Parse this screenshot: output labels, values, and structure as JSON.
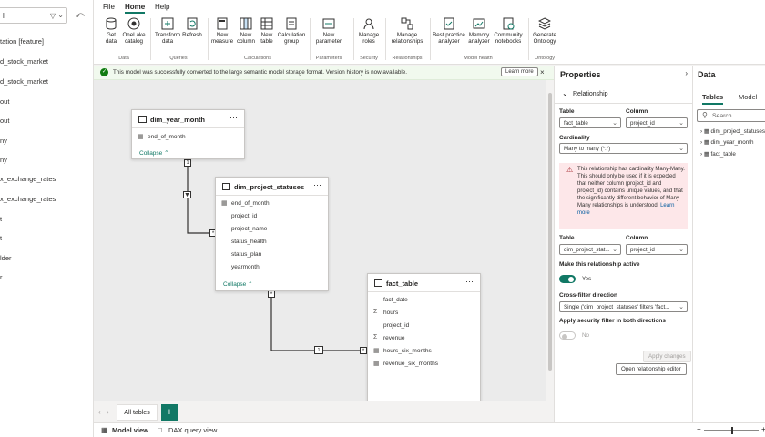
{
  "left_nav": {
    "search_value": "l",
    "items": [
      "tation [feature]",
      "d_stock_market",
      "d_stock_market",
      "out",
      "out",
      "ny",
      "ny",
      "x_exchange_rates",
      "x_exchange_rates",
      "t",
      "t",
      "lder",
      "r"
    ]
  },
  "menu": {
    "tabs": [
      "File",
      "Home",
      "Help"
    ],
    "active": "Home"
  },
  "ribbon": {
    "buttons": [
      {
        "label": "Get data",
        "icon": "database-icon"
      },
      {
        "label": "OneLake catalog",
        "icon": "onelake-icon"
      },
      {
        "label": "Transform data",
        "icon": "transform-icon"
      },
      {
        "label": "Refresh",
        "icon": "refresh-icon"
      },
      {
        "label": "New measure",
        "icon": "calculator-icon"
      },
      {
        "label": "New column",
        "icon": "column-icon"
      },
      {
        "label": "New table",
        "icon": "table-icon"
      },
      {
        "label": "Calculation group",
        "icon": "calc-group-icon"
      },
      {
        "label": "New parameter",
        "icon": "parameter-icon"
      },
      {
        "label": "Manage roles",
        "icon": "roles-icon"
      },
      {
        "label": "Manage relationships",
        "icon": "relationships-icon"
      },
      {
        "label": "Best practice analyzer",
        "icon": "analyzer-icon"
      },
      {
        "label": "Memory analyzer",
        "icon": "memory-icon"
      },
      {
        "label": "Community notebooks",
        "icon": "notebook-icon"
      },
      {
        "label": "Generate Ontology",
        "icon": "ontology-icon"
      }
    ],
    "groups": [
      "Data",
      "Queries",
      "Calculations",
      "Parameters",
      "Security",
      "Relationships",
      "Model health",
      "Ontology"
    ]
  },
  "infobar": {
    "message": "This model was successfully converted to the large semantic model storage format. Version history is now available.",
    "learn_more": "Learn more"
  },
  "canvas": {
    "tables": {
      "dim_year_month": {
        "name": "dim_year_month",
        "columns": [
          "end_of_month"
        ],
        "collapse": "Collapse"
      },
      "dim_project_statuses": {
        "name": "dim_project_statuses",
        "columns": [
          "end_of_month",
          "project_id",
          "project_name",
          "status_health",
          "status_plan",
          "yearmonth"
        ],
        "collapse": "Collapse"
      },
      "fact_table": {
        "name": "fact_table",
        "columns": [
          "fact_date",
          "hours",
          "project_id",
          "revenue",
          "hours_six_months",
          "revenue_six_months"
        ]
      }
    },
    "relationship_labels": [
      "1",
      "*",
      "*",
      "1",
      "*"
    ]
  },
  "table_tabs": {
    "all_tables": "All tables",
    "add": "+"
  },
  "status_bar": {
    "model_view": "Model view",
    "dax_query_view": "DAX query view"
  },
  "properties": {
    "title": "Properties",
    "section": "Relationship",
    "table_label": "Table",
    "column_label": "Column",
    "table1": "fact_table",
    "column1": "project_id",
    "cardinality_label": "Cardinality",
    "cardinality": "Many to many (*:*)",
    "warning": "This relationship has cardinality Many-Many. This should only be used if it is expected that neither column (project_id and project_id) contains unique values, and that the significantly different behavior of Many-Many relationships is understood.",
    "warning_link": "Learn more",
    "table2": "dim_project_stat...",
    "column2": "project_id",
    "active_label": "Make this relationship active",
    "active_value": "Yes",
    "crossfilter_label": "Cross-filter direction",
    "crossfilter": "Single ('dim_project_statuses' filters 'fact...",
    "security_label": "Apply security filter in both directions",
    "security_value": "No",
    "apply_changes": "Apply changes",
    "open_editor": "Open relationship editor"
  },
  "data_pane": {
    "title": "Data",
    "tabs": [
      "Tables",
      "Model"
    ],
    "search_placeholder": "Search",
    "tables": [
      "dim_project_statuses",
      "dim_year_month",
      "fact_table"
    ]
  },
  "colors": {
    "accent": "#117865",
    "success": "#107c10",
    "warning_bg": "#fde7e9",
    "toggle_on": "#117865"
  }
}
